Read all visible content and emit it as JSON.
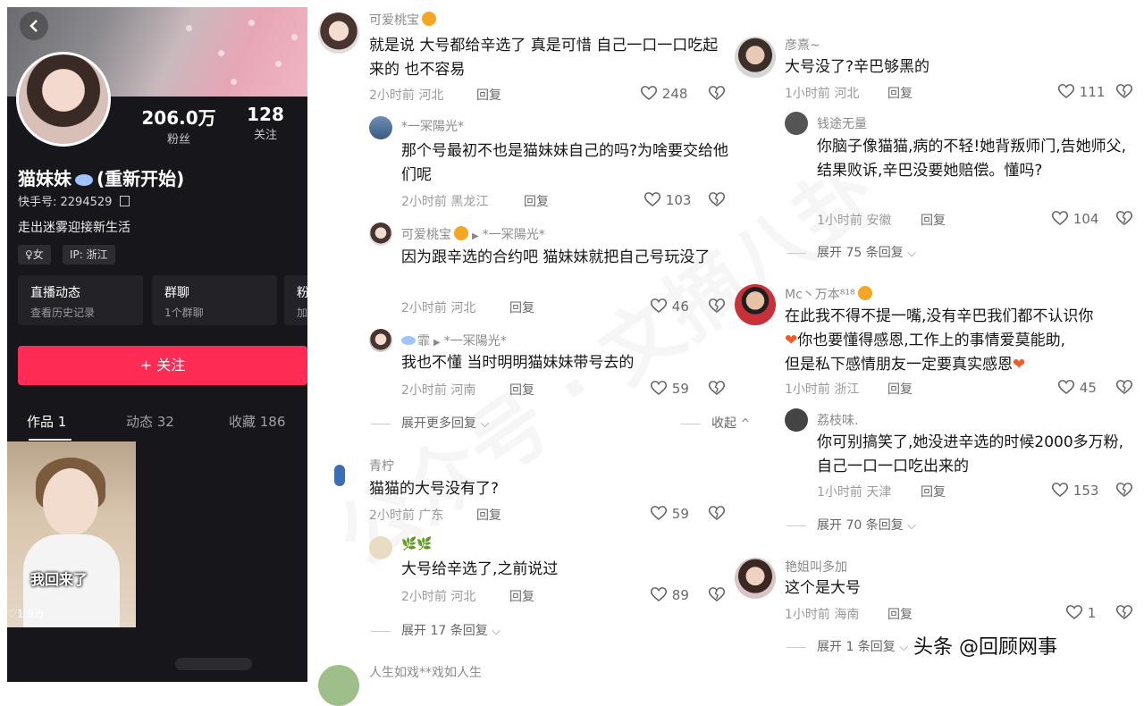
{
  "profile": {
    "followers_num": "206.0万",
    "followers_label": "粉丝",
    "following_num": "128",
    "following_label": "关注",
    "name": "猫妹妹",
    "name_suffix": "(重新开始)",
    "uid": "快手号: 2294529",
    "bio": "走出迷雾迎接新生活",
    "gender_tag": "♀女",
    "ip_tag": "IP: 浙江",
    "cards": [
      {
        "title": "直播动态",
        "sub": "查看历史记录"
      },
      {
        "title": "群聊",
        "sub": "1个群聊"
      },
      {
        "title": "粉",
        "sub": "加"
      }
    ],
    "follow_button": "+ 关注",
    "tabs": [
      "作品 1",
      "动态 32",
      "收藏 186"
    ],
    "video": {
      "caption": "我回来了",
      "likes": "♡1.9万"
    }
  },
  "comments_col1": {
    "c1": {
      "user": "可爱桃宝",
      "text": "就是说 大号都给辛选了 真是可惜 自己一口一口吃起来的 也不容易",
      "time": "2小时前 河北",
      "reply": "回复",
      "likes": "248"
    },
    "r1": {
      "user": "*一冞陽光*",
      "text": "那个号最初不也是猫妹妹自己的吗?为啥要交给他们呢",
      "time": "2小时前 黑龙江",
      "reply": "回复",
      "likes": "103"
    },
    "r2": {
      "user": "可爱桃宝",
      "to": "*一冞陽光*",
      "text": "因为跟辛选的合约吧 猫妹妹就把自己号玩没了",
      "time": "2小时前 河北",
      "reply": "回复",
      "likes": "46"
    },
    "r3": {
      "user": "霏",
      "to": "*一冞陽光*",
      "text": "我也不懂 当时明明猫妹妹带号去的",
      "time": "2小时前 河南",
      "reply": "回复",
      "likes": "59"
    },
    "expand1": "展开更多回复",
    "collapse1": "收起",
    "c2": {
      "user": "青柠",
      "text": "猫猫的大号没有了?",
      "time": "2小时前 广东",
      "reply": "回复",
      "likes": "59"
    },
    "r4": {
      "user": "🌿🌿",
      "text": "大号给辛选了,之前说过",
      "time": "2小时前 河北",
      "reply": "回复",
      "likes": "89"
    },
    "expand2": "展开 17 条回复",
    "c3": {
      "user": "人生如戏**戏如人生"
    }
  },
  "comments_col2": {
    "c1": {
      "user": "彦熹~",
      "text": "大号没了?辛巴够黑的",
      "time": "1小时前 河北",
      "reply": "回复",
      "likes": "111"
    },
    "r1": {
      "user": "钱途无量",
      "text": "你脑子像猫猫,病的不轻!她背叛师门,告她师父,结果败诉,辛巴没要她赔偿。懂吗?",
      "time": "1小时前 安徽",
      "reply": "回复",
      "likes": "104"
    },
    "expand1": "展开 75 条回复",
    "c2": {
      "user": "Mc丶万本⁸¹⁸",
      "text1": "在此我不得不提一嘴,没有辛巴我们都不认识你",
      "text2": "你也要懂得感恩,工作上的事情爱莫能助,",
      "text3": "但是私下感情朋友一定要真实感恩",
      "time": "1小时前 浙江",
      "reply": "回复",
      "likes": "45"
    },
    "r2": {
      "user": "荔枝味.",
      "text": "你可别搞笑了,她没进辛选的时候2000多万粉,自己一口一口吃出来的",
      "time": "1小时前 天津",
      "reply": "回复",
      "likes": "153"
    },
    "expand2": "展开 70 条回复",
    "c3": {
      "user": "艳姐叫多加",
      "text": "这个是大号",
      "time": "1小时前 海南",
      "reply": "回复",
      "likes": "1"
    },
    "expand3": "展开 1 条回复"
  },
  "credit": "头条 @回顾网事",
  "watermark": "公众号 · 文摘八卦"
}
